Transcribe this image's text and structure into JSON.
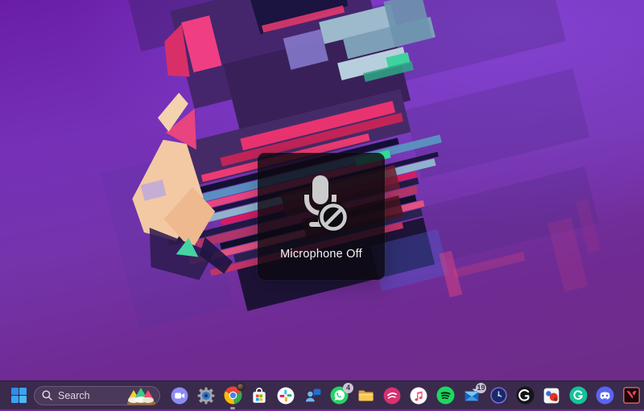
{
  "colors": {
    "taskbar_bg": "#3a2a4c",
    "search_bg": "#4a3958",
    "search_border": "#6b5a7c",
    "overlay_bg": "rgba(12,9,16,0.82)",
    "badge_bg": "#cdc5d6",
    "badge_text": "#332d40",
    "wallpaper_top": "#6a1ea8",
    "wallpaper_bottom": "#6e2c85",
    "accent_magenta": "#e8447f",
    "accent_teal": "#3fd2a0",
    "whatsapp_green": "#25d366",
    "spotify_green": "#1ed760",
    "discord_blurple": "#5865f2",
    "grammarly_green": "#15c39a",
    "valorant_red": "#ff4655",
    "windows_blue": "#3aa0f0"
  },
  "osd": {
    "label": "Microphone Off",
    "icon": "microphone-muted-icon"
  },
  "taskbar": {
    "start": {
      "icon": "windows-start-icon"
    },
    "search": {
      "placeholder": "Search",
      "icon": "search-icon",
      "decoration": "holi-color-bowls-image"
    },
    "apps": [
      {
        "name": "video-call",
        "icon": "video-camera-icon"
      },
      {
        "name": "settings",
        "icon": "gear-icon"
      },
      {
        "name": "chrome",
        "icon": "chrome-icon",
        "running": true,
        "profile_avatar": true
      },
      {
        "name": "microsoft-store",
        "icon": "store-bag-icon"
      },
      {
        "name": "slack",
        "icon": "slack-pinwheel-icon"
      },
      {
        "name": "chat",
        "icon": "person-chat-bubble-icon"
      },
      {
        "name": "whatsapp",
        "icon": "whatsapp-icon",
        "badge": "4"
      },
      {
        "name": "file-explorer",
        "icon": "folder-icon"
      },
      {
        "name": "music-pink",
        "icon": "pink-circle-swoosh-icon"
      },
      {
        "name": "itunes",
        "icon": "music-note-icon"
      },
      {
        "name": "spotify",
        "icon": "spotify-icon"
      },
      {
        "name": "mail",
        "icon": "envelope-icon",
        "badge": "19"
      },
      {
        "name": "clock",
        "icon": "clock-icon"
      },
      {
        "name": "logitech-ghub",
        "icon": "logitech-g-icon"
      },
      {
        "name": "photos",
        "icon": "photo-blob-icon"
      },
      {
        "name": "grammarly",
        "icon": "grammarly-g-icon"
      },
      {
        "name": "discord",
        "icon": "discord-icon"
      },
      {
        "name": "valorant",
        "icon": "valorant-v-icon"
      }
    ]
  }
}
